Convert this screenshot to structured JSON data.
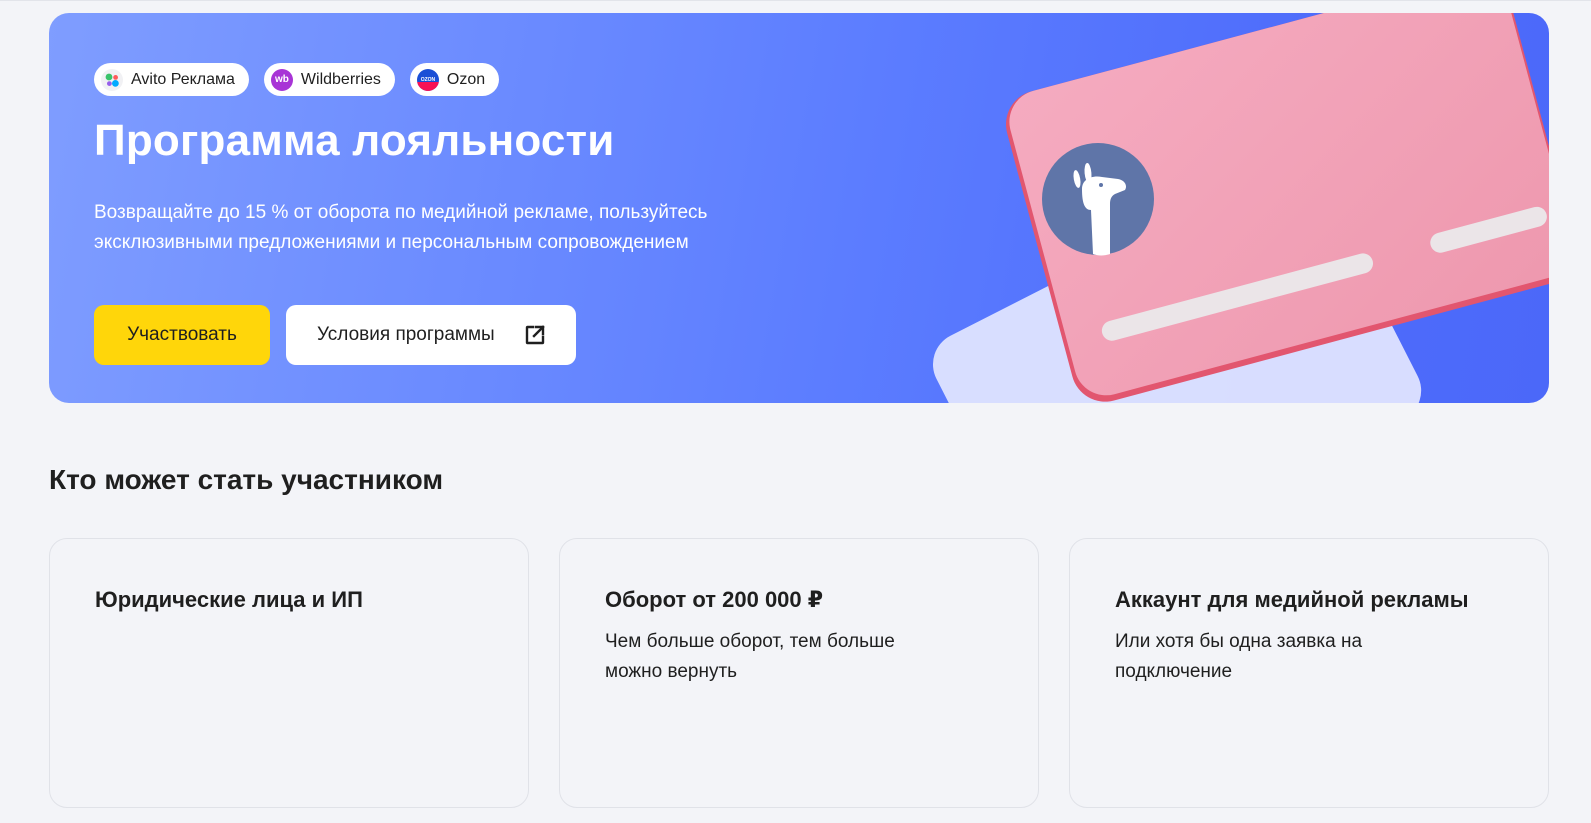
{
  "hero": {
    "badges": [
      {
        "label": "Avito Реклама",
        "icon": "avito-logo-icon"
      },
      {
        "label": "Wildberries",
        "icon": "wildberries-logo-icon",
        "logo_text": "wb"
      },
      {
        "label": "Ozon",
        "icon": "ozon-logo-icon",
        "logo_text": "OZON"
      }
    ],
    "title": "Программа лояльности",
    "description": "Возвращайте до 15 % от оборота по медийной рекламе, пользуйтесь эксклюзивными предложениями и персональным сопровождением",
    "primary_button": "Участвовать",
    "secondary_button": "Условия программы",
    "secondary_button_icon": "external-link-icon"
  },
  "section": {
    "title": "Кто может стать участником",
    "cards": [
      {
        "title": "Юридические лица и ИП",
        "text": ""
      },
      {
        "title": "Оборот от 200 000 ₽",
        "text": "Чем больше оборот, тем больше можно вернуть"
      },
      {
        "title": "Аккаунт для медийной рекламы",
        "text": "Или хотя бы одна заявка на подключение"
      }
    ]
  },
  "colors": {
    "page_background": "#f3f4f8",
    "hero_gradient_start": "#7f9dff",
    "hero_gradient_end": "#4b68f9",
    "primary_button": "#ffd60a",
    "card_pink": "#f2a1b5",
    "card_back": "#dfe4ff",
    "mascot_circle": "#5f75a8",
    "wildberries": "#a834d6",
    "ozon": "#1a4fd6"
  }
}
